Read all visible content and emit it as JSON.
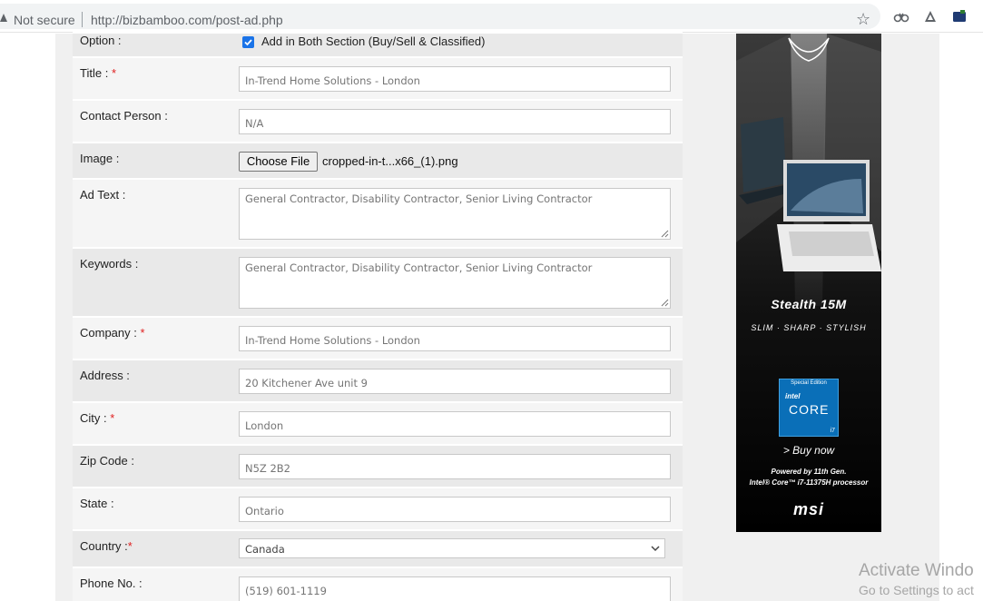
{
  "browser": {
    "security_label": "Not secure",
    "url": "http://bizbamboo.com/post-ad.php",
    "icons": [
      "warning-icon",
      "star-icon",
      "extension-icon",
      "extension-icon",
      "extension-icon"
    ]
  },
  "form": {
    "option": {
      "label": "Option :",
      "checkbox_label": "Add in Both Section (Buy/Sell & Classified)",
      "checked": true
    },
    "title": {
      "label": "Title :",
      "required_mark": "*",
      "value": "In-Trend Home Solutions - London"
    },
    "contact_person": {
      "label": "Contact Person :",
      "value": "N/A"
    },
    "image": {
      "label": "Image :",
      "button_label": "Choose File",
      "file_name": "cropped-in-t...x66_(1).png"
    },
    "ad_text": {
      "label": "Ad Text :",
      "value": "General Contractor, Disability Contractor, Senior Living Contractor"
    },
    "keywords": {
      "label": "Keywords :",
      "value": "General Contractor, Disability Contractor, Senior Living Contractor"
    },
    "company": {
      "label": "Company :",
      "required_mark": "*",
      "value": "In-Trend Home Solutions - London"
    },
    "address": {
      "label": "Address :",
      "value": "20 Kitchener Ave unit 9"
    },
    "city": {
      "label": "City :",
      "required_mark": "*",
      "value": "London"
    },
    "zip_code": {
      "label": "Zip Code :",
      "value": "N5Z 2B2"
    },
    "state": {
      "label": "State :",
      "value": "Ontario"
    },
    "country": {
      "label": "Country :",
      "required_mark": "*",
      "value": "Canada"
    },
    "phone": {
      "label": "Phone No. :",
      "value": "(519) 601-1119"
    }
  },
  "ad": {
    "product": "Stealth 15M",
    "slogan": "SLIM · SHARP · STYLISH",
    "badge_top": "Special Edition",
    "badge_brand": "intel",
    "badge_core": "CORE",
    "badge_model": "i7",
    "cta": "> Buy now",
    "powered_line1": "Powered by 11th Gen.",
    "powered_line2": "Intel® Core™ i7-11375H processor",
    "brand": "msi"
  },
  "watermark": {
    "line1": "Activate Windo",
    "line2": "Go to Settings to act"
  },
  "colors": {
    "accent": "#1a73e8",
    "required": "#e02020",
    "row_light": "#f5f5f5",
    "row_dark": "#e9e9e9"
  }
}
